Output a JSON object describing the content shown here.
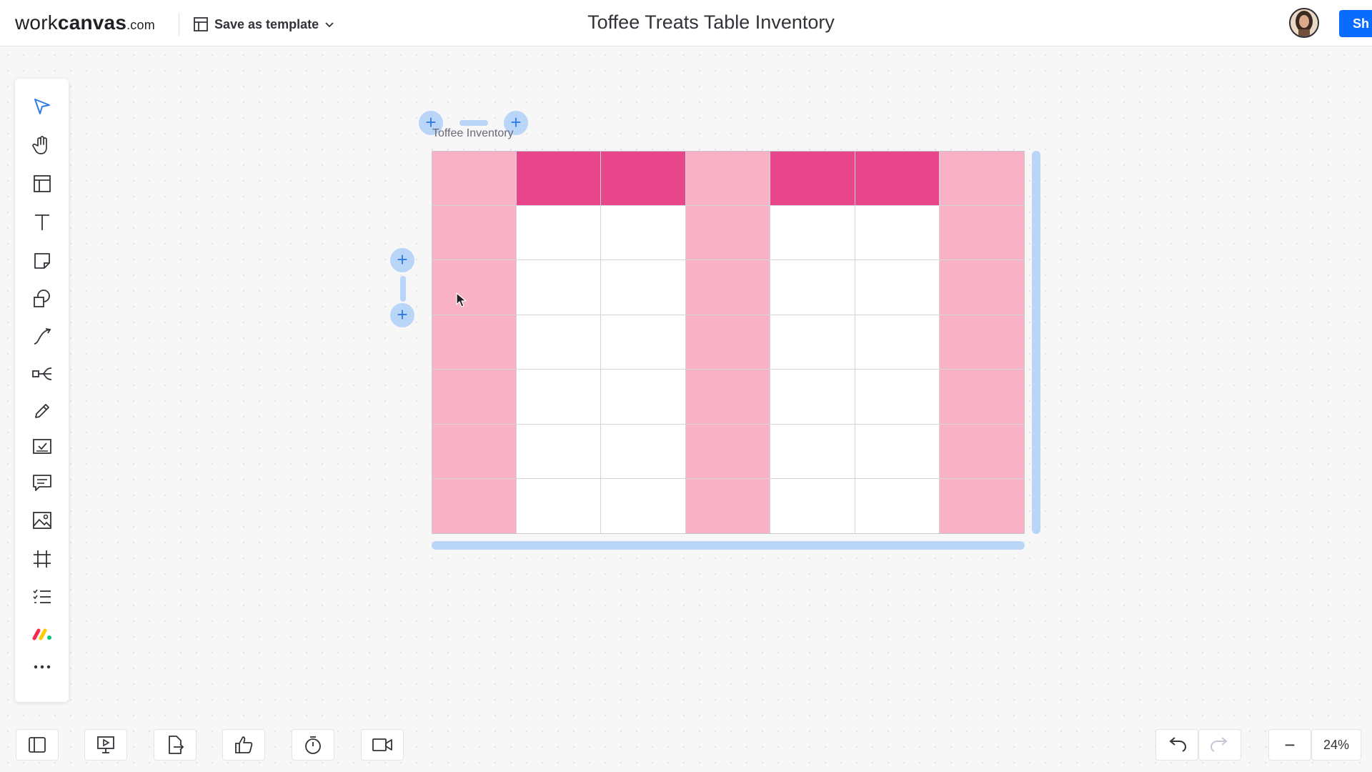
{
  "header": {
    "logo_main": "work",
    "logo_bold": "canvas",
    "logo_domain": ".com",
    "template_label": "Save as template",
    "board_title": "Toffee Treats Table Inventory",
    "share_label": "Sh"
  },
  "toolbar": {
    "items": [
      {
        "name": "select-tool",
        "icon": "pointer-icon"
      },
      {
        "name": "hand-tool",
        "icon": "hand-icon"
      },
      {
        "name": "template-tool",
        "icon": "layout-icon"
      },
      {
        "name": "text-tool",
        "icon": "text-icon"
      },
      {
        "name": "sticky-note-tool",
        "icon": "sticky-note-icon"
      },
      {
        "name": "shapes-tool",
        "icon": "shapes-icon"
      },
      {
        "name": "connector-tool",
        "icon": "connector-icon"
      },
      {
        "name": "mind-map-tool",
        "icon": "mind-map-icon"
      },
      {
        "name": "pen-tool",
        "icon": "pencil-icon"
      },
      {
        "name": "checklist-tool",
        "icon": "checkbox-icon"
      },
      {
        "name": "comment-tool",
        "icon": "comment-icon"
      },
      {
        "name": "image-tool",
        "icon": "image-icon"
      },
      {
        "name": "frame-tool",
        "icon": "frame-icon"
      },
      {
        "name": "list-tool",
        "icon": "list-icon"
      },
      {
        "name": "integrations-tool",
        "icon": "monday-logo-icon"
      },
      {
        "name": "more-tool",
        "icon": "more-icon"
      }
    ]
  },
  "canvas": {
    "table_title": "Toffee Inventory",
    "table": {
      "columns": 7,
      "rows": 7,
      "header_colors": [
        "#f9b1c6",
        "#e8468a",
        "#e8468a",
        "#f9b1c6",
        "#e8468a",
        "#e8468a",
        "#f9b1c6"
      ],
      "body_colors": [
        "#f9b1c6",
        "#ffffff",
        "#ffffff",
        "#f9b1c6",
        "#ffffff",
        "#ffffff",
        "#f9b1c6"
      ]
    },
    "add_symbol": "+"
  },
  "bottombar": {
    "zoom_label": "24%",
    "minus_label": "−"
  },
  "colors": {
    "accent": "#0a6cff",
    "handle": "#b9d5f7",
    "light_pink": "#f9b1c6",
    "dark_pink": "#e8468a"
  }
}
